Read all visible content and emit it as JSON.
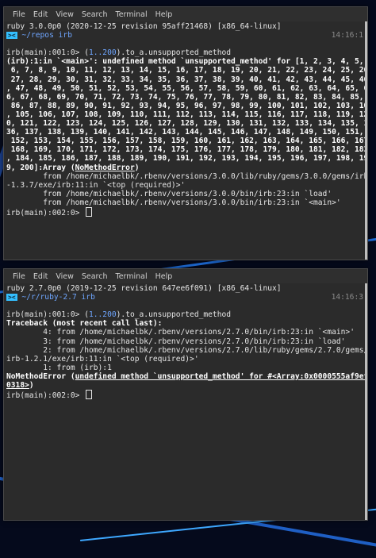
{
  "colors": {
    "accent": "#34bfff",
    "path": "#6fa6ff",
    "number": "#6fa6ff"
  },
  "menu": [
    "File",
    "Edit",
    "View",
    "Search",
    "Terminal",
    "Help"
  ],
  "term1": {
    "version_line": "ruby 3.0.0p0 (2020-12-25 revision 95aff21468) [x86_64-linux]",
    "prompt_path": "~/repos",
    "prompt_branch": "irb",
    "time": "14:16:1",
    "cmd_prompt": "irb(main):001:0> ",
    "cmd_range_open": "(",
    "cmd_range": "1..200",
    "cmd_rest": ").to_a.unsupported_method",
    "error_lines": [
      "(irb):1:in `<main>': undefined method `unsupported_method' for [1, 2, 3, 4, 5,",
      " 6, 7, 8, 9, 10, 11, 12, 13, 14, 15, 16, 17, 18, 19, 20, 21, 22, 23, 24, 25, 26,",
      " 27, 28, 29, 30, 31, 32, 33, 34, 35, 36, 37, 38, 39, 40, 41, 42, 43, 44, 45, 46",
      ", 47, 48, 49, 50, 51, 52, 53, 54, 55, 56, 57, 58, 59, 60, 61, 62, 63, 64, 65, 6",
      "6, 67, 68, 69, 70, 71, 72, 73, 74, 75, 76, 77, 78, 79, 80, 81, 82, 83, 84, 85,",
      " 86, 87, 88, 89, 90, 91, 92, 93, 94, 95, 96, 97, 98, 99, 100, 101, 102, 103, 104",
      ", 105, 106, 107, 108, 109, 110, 111, 112, 113, 114, 115, 116, 117, 118, 119, 12",
      "0, 121, 122, 123, 124, 125, 126, 127, 128, 129, 130, 131, 132, 133, 134, 135, 1",
      "36, 137, 138, 139, 140, 141, 142, 143, 144, 145, 146, 147, 148, 149, 150, 151,",
      " 152, 153, 154, 155, 156, 157, 158, 159, 160, 161, 162, 163, 164, 165, 166, 167,",
      " 168, 169, 170, 171, 172, 173, 174, 175, 176, 177, 178, 179, 180, 181, 182, 183",
      ", 184, 185, 186, 187, 188, 189, 190, 191, 192, 193, 194, 195, 196, 197, 198, 19"
    ],
    "error_last_pre": "9, 200]:Array (",
    "error_last_cls": "NoMethodError",
    "error_last_post": ")",
    "trace": [
      "        from /home/michaelbk/.rbenv/versions/3.0.0/lib/ruby/gems/3.0.0/gems/irb",
      "-1.3.7/exe/irb:11:in `<top (required)>'",
      "        from /home/michaelbk/.rbenv/versions/3.0.0/bin/irb:23:in `load'",
      "        from /home/michaelbk/.rbenv/versions/3.0.0/bin/irb:23:in `<main>'"
    ],
    "final_prompt": "irb(main):002:0> "
  },
  "term2": {
    "version_line": "ruby 2.7.0p0 (2019-12-25 revision 647ee6f091) [x86_64-linux]",
    "prompt_path": "~/r/ruby-2.7",
    "prompt_branch": "irb",
    "time": "14:16:3",
    "cmd_prompt": "irb(main):001:0> ",
    "cmd_range_open": "(",
    "cmd_range": "1..200",
    "cmd_rest": ").to_a.unsupported_method",
    "traceback_header": "Traceback (most recent call last):",
    "trace": [
      "        4: from /home/michaelbk/.rbenv/versions/2.7.0/bin/irb:23:in `<main>'",
      "        3: from /home/michaelbk/.rbenv/versions/2.7.0/bin/irb:23:in `load'",
      "        2: from /home/michaelbk/.rbenv/versions/2.7.0/lib/ruby/gems/2.7.0/gems/",
      "irb-1.2.1/exe/irb:11:in `<top (required)>'",
      "        1: from (irb):1"
    ],
    "error_pre": "NoMethodError (",
    "error_msg": "undefined method `unsupported_method' for #<Array:0x0000555af9ef",
    "error_msg2": "0318>",
    "error_post": ")",
    "final_prompt": "irb(main):002:0> "
  }
}
